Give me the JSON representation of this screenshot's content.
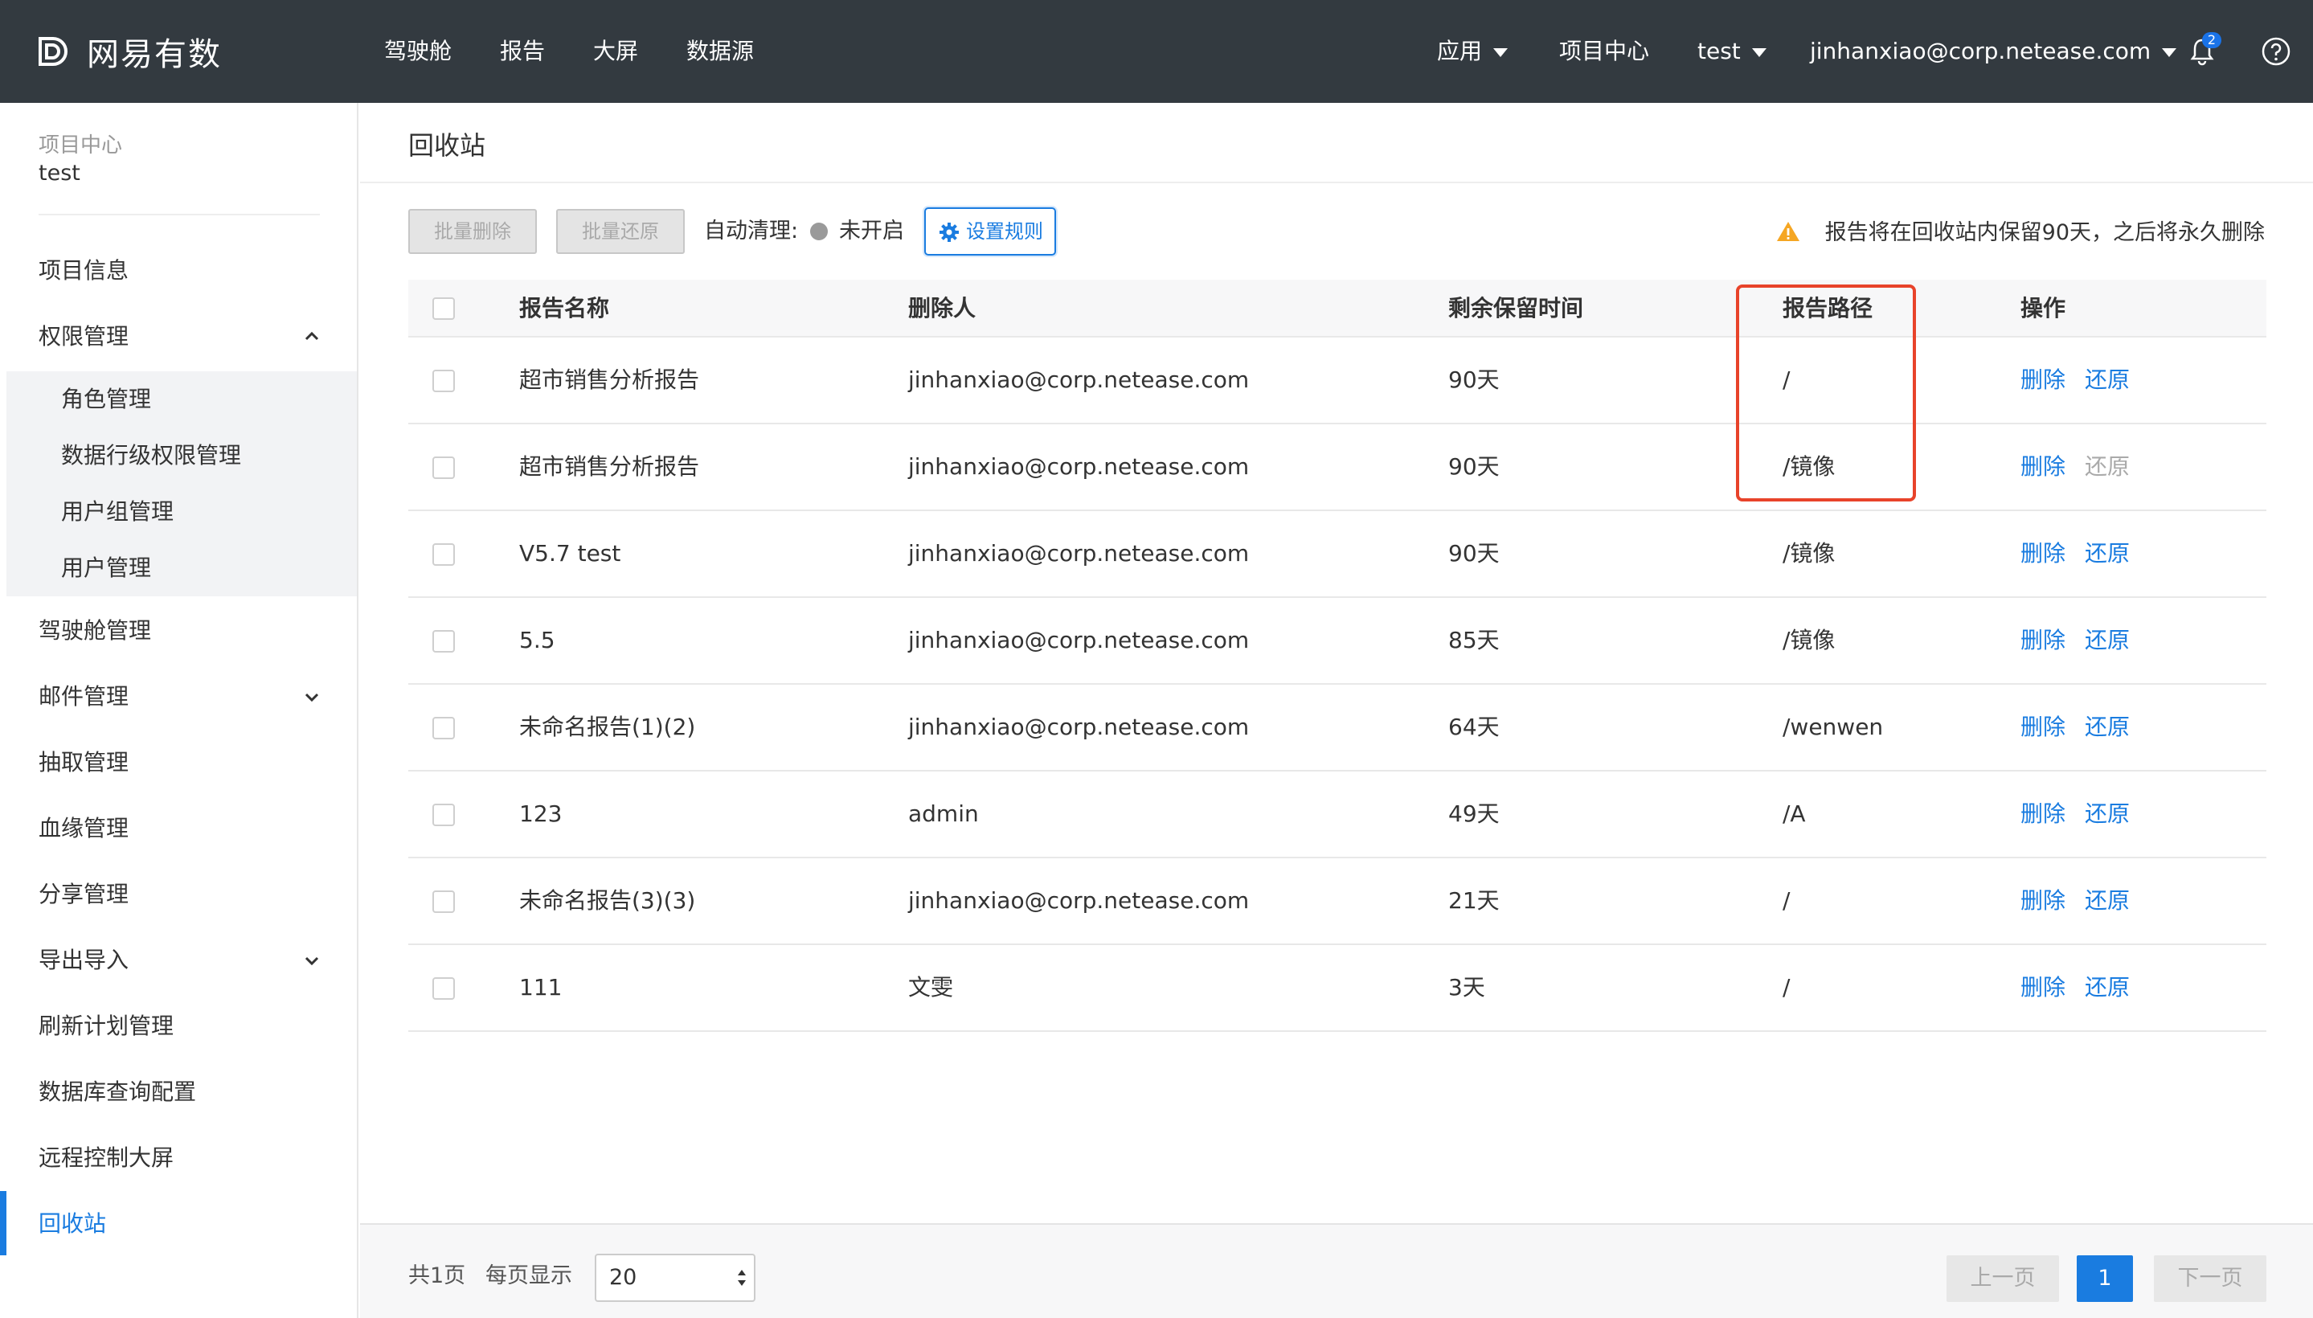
{
  "app": {
    "brand": "网易有数",
    "nav": [
      "驾驶舱",
      "报告",
      "大屏",
      "数据源"
    ],
    "right_nav": {
      "apps": "应用",
      "project_center": "项目中心",
      "project": "test",
      "user": "jinhanxiao@corp.netease.com",
      "notification_count": "2"
    },
    "colors": {
      "topbar": "#333a40",
      "accent": "#1a7ce0",
      "highlight": "#e8432a"
    }
  },
  "sidebar": {
    "project_label": "项目中心",
    "project_name": "test",
    "items": [
      {
        "label": "项目信息"
      },
      {
        "label": "权限管理",
        "expanded": true,
        "children": [
          "角色管理",
          "数据行级权限管理",
          "用户组管理",
          "用户管理"
        ]
      },
      {
        "label": "驾驶舱管理"
      },
      {
        "label": "邮件管理",
        "expandable": true
      },
      {
        "label": "抽取管理"
      },
      {
        "label": "血缘管理"
      },
      {
        "label": "分享管理"
      },
      {
        "label": "导出导入",
        "expandable": true
      },
      {
        "label": "刷新计划管理"
      },
      {
        "label": "数据库查询配置"
      },
      {
        "label": "远程控制大屏"
      },
      {
        "label": "回收站",
        "active": true
      }
    ]
  },
  "main": {
    "title": "回收站",
    "toolbar": {
      "batch_delete": "批量删除",
      "batch_restore": "批量还原",
      "auto_clean_label": "自动清理:",
      "auto_clean_status": "未开启",
      "rule_button": "设置规则",
      "notice": "报告将在回收站内保留90天，之后将永久删除"
    },
    "table": {
      "columns": [
        "报告名称",
        "删除人",
        "剩余保留时间",
        "报告路径",
        "操作"
      ],
      "actions": {
        "delete": "删除",
        "restore": "还原"
      },
      "rows": [
        {
          "name": "超市销售分析报告",
          "deleter": "jinhanxiao@corp.netease.com",
          "remaining": "90天",
          "path": "/",
          "restore_enabled": true
        },
        {
          "name": "超市销售分析报告",
          "deleter": "jinhanxiao@corp.netease.com",
          "remaining": "90天",
          "path": "/镜像",
          "restore_enabled": false
        },
        {
          "name": "V5.7 test",
          "deleter": "jinhanxiao@corp.netease.com",
          "remaining": "90天",
          "path": "/镜像",
          "restore_enabled": true
        },
        {
          "name": "5.5",
          "deleter": "jinhanxiao@corp.netease.com",
          "remaining": "85天",
          "path": "/镜像",
          "restore_enabled": true
        },
        {
          "name": "未命名报告(1)(2)",
          "deleter": "jinhanxiao@corp.netease.com",
          "remaining": "64天",
          "path": "/wenwen",
          "restore_enabled": true
        },
        {
          "name": "123",
          "deleter": "admin",
          "remaining": "49天",
          "path": "/A",
          "restore_enabled": true
        },
        {
          "name": "未命名报告(3)(3)",
          "deleter": "jinhanxiao@corp.netease.com",
          "remaining": "21天",
          "path": "/",
          "restore_enabled": true
        },
        {
          "name": "111",
          "deleter": "文雯",
          "remaining": "3天",
          "path": "/",
          "restore_enabled": true
        }
      ]
    }
  },
  "footer": {
    "total": "共1页",
    "per_page_label": "每页显示",
    "per_page_value": "20",
    "prev": "上一页",
    "current_page": "1",
    "next": "下一页"
  }
}
